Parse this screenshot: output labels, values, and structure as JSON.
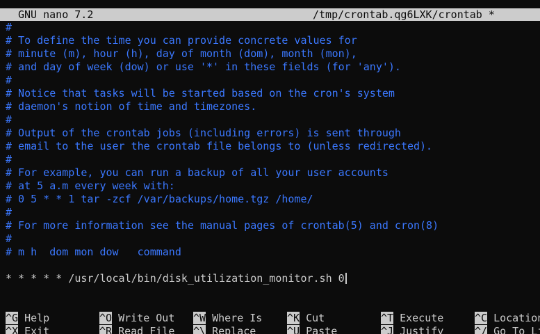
{
  "title_bar": {
    "app": "GNU nano 7.2",
    "file": "/tmp/crontab.qg6LXK/crontab *"
  },
  "editor": {
    "lines": [
      {
        "text": "#",
        "type": "comment"
      },
      {
        "text": "# To define the time you can provide concrete values for",
        "type": "comment"
      },
      {
        "text": "# minute (m), hour (h), day of month (dom), month (mon),",
        "type": "comment"
      },
      {
        "text": "# and day of week (dow) or use '*' in these fields (for 'any').",
        "type": "comment"
      },
      {
        "text": "#",
        "type": "comment"
      },
      {
        "text": "# Notice that tasks will be started based on the cron's system",
        "type": "comment"
      },
      {
        "text": "# daemon's notion of time and timezones.",
        "type": "comment"
      },
      {
        "text": "#",
        "type": "comment"
      },
      {
        "text": "# Output of the crontab jobs (including errors) is sent through",
        "type": "comment"
      },
      {
        "text": "# email to the user the crontab file belongs to (unless redirected).",
        "type": "comment"
      },
      {
        "text": "#",
        "type": "comment"
      },
      {
        "text": "# For example, you can run a backup of all your user accounts",
        "type": "comment"
      },
      {
        "text": "# at 5 a.m every week with:",
        "type": "comment"
      },
      {
        "text": "# 0 5 * * 1 tar -zcf /var/backups/home.tgz /home/",
        "type": "comment"
      },
      {
        "text": "#",
        "type": "comment"
      },
      {
        "text": "# For more information see the manual pages of crontab(5) and cron(8)",
        "type": "comment"
      },
      {
        "text": "#",
        "type": "comment"
      },
      {
        "text": "# m h  dom mon dow   command",
        "type": "comment"
      },
      {
        "text": "",
        "type": "plain"
      },
      {
        "text": "* * * * * /usr/local/bin/disk_utilization_monitor.sh 0",
        "type": "plain"
      }
    ]
  },
  "shortcuts": {
    "row1": [
      {
        "key": "^G",
        "label": "Help"
      },
      {
        "key": "^O",
        "label": "Write Out"
      },
      {
        "key": "^W",
        "label": "Where Is"
      },
      {
        "key": "^K",
        "label": "Cut"
      },
      {
        "key": "^T",
        "label": "Execute"
      },
      {
        "key": "^C",
        "label": "Location"
      }
    ],
    "row2": [
      {
        "key": "^X",
        "label": "Exit"
      },
      {
        "key": "^R",
        "label": "Read File"
      },
      {
        "key": "^\\",
        "label": "Replace"
      },
      {
        "key": "^U",
        "label": "Paste"
      },
      {
        "key": "^J",
        "label": "Justify"
      },
      {
        "key": "^/",
        "label": "Go To Line"
      }
    ]
  },
  "colors": {
    "background": "#0c0c0c",
    "foreground": "#cccccc",
    "comment": "#3b78ff",
    "title_bar_bg": "#cccccc"
  }
}
